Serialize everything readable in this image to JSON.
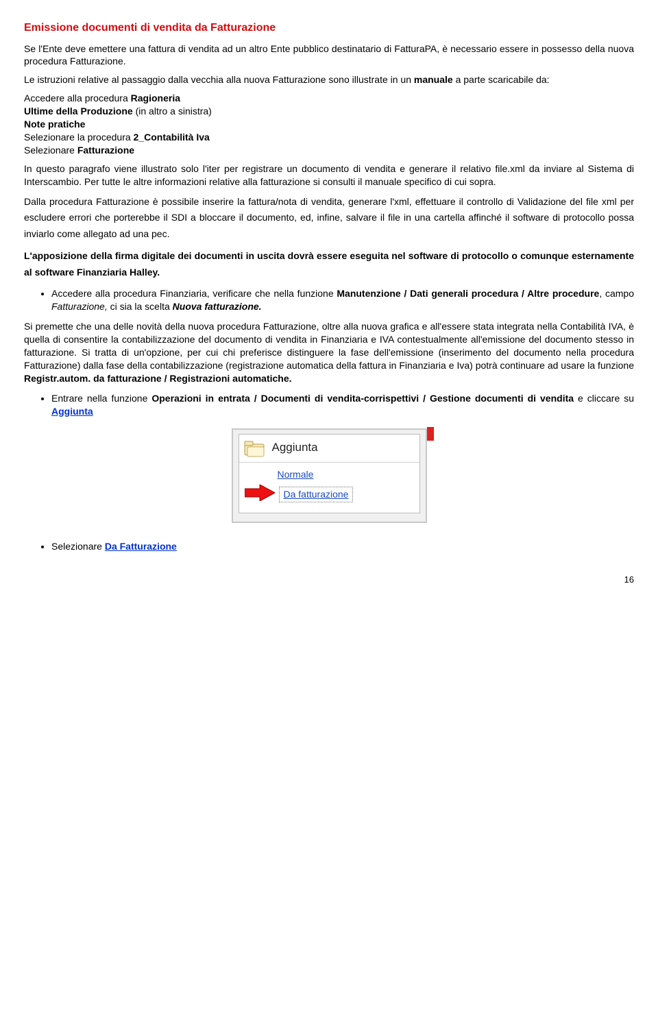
{
  "title": "Emissione documenti di vendita da Fatturazione",
  "p1": "Se l'Ente deve emettere una fattura di vendita ad un altro Ente pubblico destinatario di FatturaPA, è necessario essere in possesso della nuova procedura Fatturazione.",
  "p2a": "Le istruzioni relative al passaggio dalla vecchia alla nuova Fatturazione sono illustrate in un ",
  "p2b": "manuale",
  "p2c": " a parte scaricabile da:",
  "steps": {
    "s1a": "Accedere alla procedura ",
    "s1b": "Ragioneria",
    "s2a": "Ultime della Produzione",
    "s2b": " (in altro a sinistra)",
    "s3": "Note pratiche",
    "s4a": "Selezionare la procedura ",
    "s4b": "2_Contabilità Iva",
    "s5a": "Selezionare ",
    "s5b": "Fatturazione"
  },
  "p3": "In questo paragrafo viene illustrato solo l'iter per registrare un documento di vendita e generare il relativo file.xml da inviare al Sistema di Interscambio. Per tutte le altre informazioni relative alla fatturazione si consulti il manuale specifico di cui sopra.",
  "p4": "Dalla procedura Fatturazione è possibile inserire la fattura/nota di vendita, generare l'xml, effettuare il controllo di Validazione del file xml per escludere errori che porterebbe il SDI a bloccare il documento, ed, infine, salvare il file in una cartella affinché il software di protocollo possa inviarlo come allegato ad una pec.",
  "p5": "L'apposizione della firma digitale dei documenti in uscita dovrà essere eseguita nel software di protocollo o comunque esternamente al software Finanziaria Halley.",
  "b1a": "Accedere alla procedura Finanziaria, verificare che nella funzione ",
  "b1b": "Manutenzione / Dati generali procedura / Altre procedure",
  "b1c": ", campo ",
  "b1d": "Fatturazione,",
  "b1e": "  ci sia la scelta ",
  "b1f": "Nuova fatturazione.",
  "p6a": "Si premette che una delle novità della nuova procedura Fatturazione, oltre alla nuova grafica e all'essere stata integrata nella Contabilità IVA, è quella di consentire la contabilizzazione del documento di vendita in Finanziaria e IVA contestualmente all'emissione del documento stesso in fatturazione. Si tratta di un'opzione, per cui chi preferisce distinguere la fase dell'emissione (inserimento del documento nella procedura Fatturazione) dalla fase della contabilizzazione (registrazione automatica della fattura in Finanziaria e Iva) potrà continuare ad usare la funzione ",
  "p6b": "Registr.autom. da fatturazione / Registrazioni automatiche.",
  "b2a": "Entrare nella funzione ",
  "b2b": "Operazioni in entrata / Documenti di vendita-corrispettivi / Gestione documenti di vendita",
  "b2c": " e cliccare su",
  "b2d": " Aggiunta",
  "shot": {
    "aggiunta": "Aggiunta",
    "normale": "Normale",
    "dafatt": "Da fatturazione"
  },
  "b3a": "Selezionare ",
  "b3b": "Da Fatturazione",
  "page": "16"
}
